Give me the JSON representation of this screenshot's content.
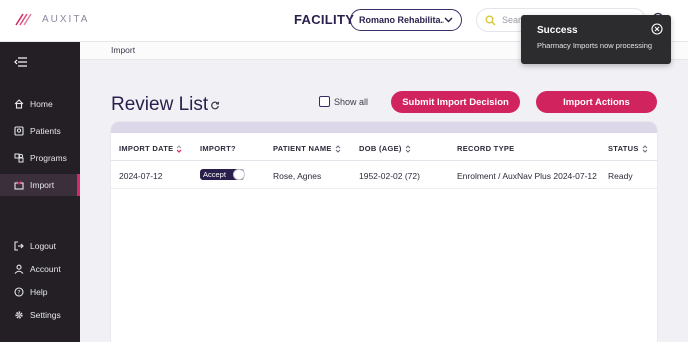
{
  "brand": {
    "name": "AUXITA",
    "accent": "#d1245e",
    "primary": "#2a1f4c"
  },
  "header": {
    "facility_label": "FACILITY",
    "facility_value": "Romano Rehabilita...",
    "search_placeholder": "Search"
  },
  "sidebar": {
    "items": [
      {
        "label": "Home",
        "icon": "home-icon"
      },
      {
        "label": "Patients",
        "icon": "patients-icon"
      },
      {
        "label": "Programs",
        "icon": "programs-icon"
      },
      {
        "label": "Import",
        "icon": "import-icon",
        "active": true
      },
      {
        "label": "Logout",
        "icon": "logout-icon"
      },
      {
        "label": "Account",
        "icon": "account-icon"
      },
      {
        "label": "Help",
        "icon": "help-icon"
      },
      {
        "label": "Settings",
        "icon": "settings-icon"
      }
    ]
  },
  "breadcrumb": "Import",
  "main": {
    "title": "Review List",
    "show_all_label": "Show all",
    "show_all_checked": false,
    "submit_label": "Submit Import Decision",
    "actions_label": "Import Actions"
  },
  "table": {
    "columns": [
      "IMPORT DATE",
      "IMPORT?",
      "PATIENT NAME",
      "DOB (AGE)",
      "RECORD TYPE",
      "STATUS"
    ],
    "rows": [
      {
        "import_date": "2024-07-12",
        "import_toggle": "Accept",
        "patient_name": "Rose, Agnes",
        "dob": "1952-02-02 (72)",
        "record_type": "Enrolment / AuxNav Plus 2024-07-12",
        "status": "Ready"
      }
    ]
  },
  "toast": {
    "title": "Success",
    "message": "Pharmacy Imports now processing"
  }
}
